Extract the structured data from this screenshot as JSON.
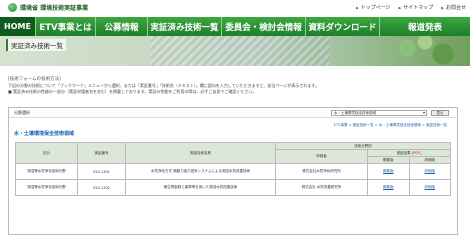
{
  "header": {
    "logo_text": "環境省 環境技術実証事業",
    "util_links": [
      "トップページ",
      "サイトマップ",
      "お問合せ"
    ]
  },
  "nav": {
    "items": [
      "HOME",
      "ETV事業とは",
      "公募情報",
      "実証済み技術一覧",
      "委員会・検討会情報",
      "資料ダウンロード",
      "報道発表"
    ]
  },
  "page": {
    "title": "実証済み技術一覧",
    "section_head": "[技術フォームの技術方法]",
    "notes": [
      "下記の分野の技術について「ブックマーク」メニューから選択、または「実証番号」「技術名（テキスト）」欄に語句を入力していただきますと、該当ページが表示されます。",
      "■ 実証済み技術の性能の一部分（実証申請者名を含む）を掲載しております。実証の性能をご利用の際は、必ずご自身でご確認ください。"
    ]
  },
  "panel": {
    "label": "分野選択",
    "select_value": "水・土壌環境保全技術領域",
    "go_label": "表示",
    "breadcrumb": "ETV事業 > 実証技術一覧 > 水・土壌環境保全技術領域 > 実証技術一覧",
    "category_title": "水・土壌環境保全技術領域",
    "table": {
      "group_header": "技術分野別",
      "columns": [
        "区分",
        "実証番号",
        "実証技術名称",
        "申請者",
        "実証結果",
        "概要版",
        "詳細版"
      ],
      "new_label": "[PDF]",
      "rows": [
        {
          "category": "湖沼等水質浄化技術分野",
          "number": "020-1301",
          "name": "水質浄化方式 無動力強力送気システムによる湖沼水質改善技術",
          "applicant": "株式会社水質浄化研究所",
          "summary": "概要版",
          "detail": "詳細版"
        },
        {
          "category": "湖沼等水質浄化技術分野",
          "number": "020-1302",
          "name": "微生物製剤と薬草等を用いた湖沼水質改善技術",
          "applicant": "株式会社 水質改善研究所",
          "summary": "概要版",
          "detail": "詳細版"
        }
      ]
    }
  },
  "colors": {
    "nav_green": "#1e7f2c",
    "home_green": "#0f5a1c",
    "link_blue": "#1a5fb4"
  }
}
